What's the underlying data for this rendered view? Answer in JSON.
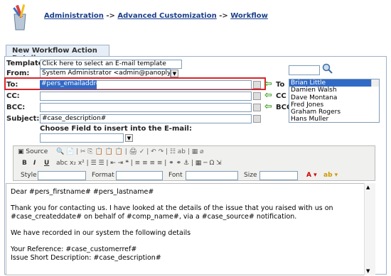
{
  "breadcrumb": {
    "items": [
      "Administration",
      "Advanced Customization",
      "Workflow"
    ],
    "separator": "->"
  },
  "tab_title": "New Workflow Action Details",
  "form": {
    "template_label": "Template:",
    "template_value": "Click here to select an E-mail template",
    "from_label": "From:",
    "from_value": "System Administrator <admin@panoplytech.com>",
    "to_label": "To:",
    "to_value": "#pers_emailaddress#",
    "cc_label": "CC:",
    "cc_value": "",
    "bcc_label": "BCC:",
    "bcc_value": "",
    "subject_label": "Subject:",
    "subject_value": "#case_description#",
    "choose_field_label": "Choose Field to insert into the E-mail:",
    "choose_field_value": ""
  },
  "recipients": {
    "search_value": "",
    "to_btn": "To",
    "cc_btn": "CC",
    "bcc_btn": "BCC",
    "users": [
      "Brian Little",
      "Damien Walsh",
      "Dave Montana",
      "Fred Jones",
      "Graham Rogers",
      "Hans Muller"
    ],
    "selected": "Brian Little"
  },
  "toolbar": {
    "source_label": "Source",
    "style_label": "Style",
    "format_label": "Format",
    "font_label": "Font",
    "size_label": "Size"
  },
  "editor": {
    "paragraphs": [
      "Dear #pers_firstname# #pers_lastname#",
      "Thank you for contacting us.  I have looked at the details of the issue that you raised with us on #case_createddate# on behalf of #comp_name#, via a #case_source# notification.",
      "We have recorded in our system the following details",
      "Your Reference: #case_customerref#\nIssue Short Description: #case_description#"
    ]
  },
  "colors": {
    "highlight": "#d8232a",
    "selection": "#316ac5",
    "link": "#1a3e8c"
  }
}
